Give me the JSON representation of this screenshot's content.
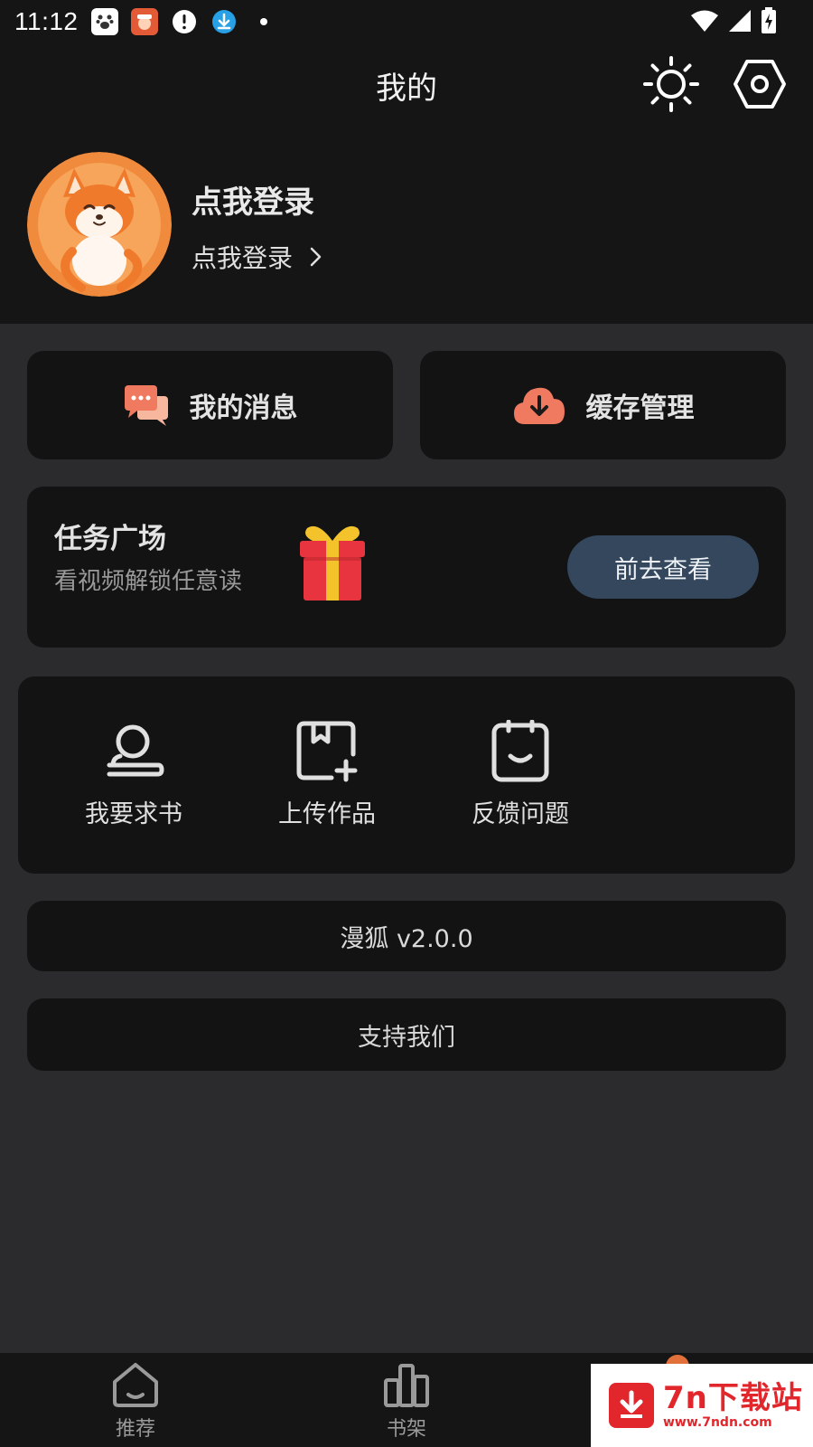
{
  "status_bar": {
    "time": "11:12"
  },
  "header": {
    "title": "我的",
    "theme_icon": "sun-icon",
    "settings_icon": "hexagon-settings-icon"
  },
  "profile": {
    "name": "点我登录",
    "link": "点我登录"
  },
  "quick_actions": [
    {
      "label": "我的消息",
      "icon": "chat-bubbles-icon"
    },
    {
      "label": "缓存管理",
      "icon": "cloud-download-icon"
    }
  ],
  "task": {
    "title": "任务广场",
    "subtitle": "看视频解锁任意读",
    "button": "前去查看",
    "icon": "gift-icon"
  },
  "tools": [
    {
      "label": "我要求书",
      "icon": "request-book-icon"
    },
    {
      "label": "上传作品",
      "icon": "upload-work-icon"
    },
    {
      "label": "反馈问题",
      "icon": "feedback-icon"
    }
  ],
  "version": "漫狐 v2.0.0",
  "support": "支持我们",
  "bottom_nav": [
    {
      "label": "推荐",
      "icon": "home-icon"
    },
    {
      "label": "书架",
      "icon": "bookshelf-icon"
    }
  ],
  "watermark": {
    "name": "7n下载站",
    "url": "www.7ndn.com"
  },
  "colors": {
    "background": "#2b2b2d",
    "surface": "#131314",
    "accent": "#f07a5f",
    "button": "#34475d",
    "gift_red": "#e8343f",
    "gift_gold": "#f4c22b"
  }
}
